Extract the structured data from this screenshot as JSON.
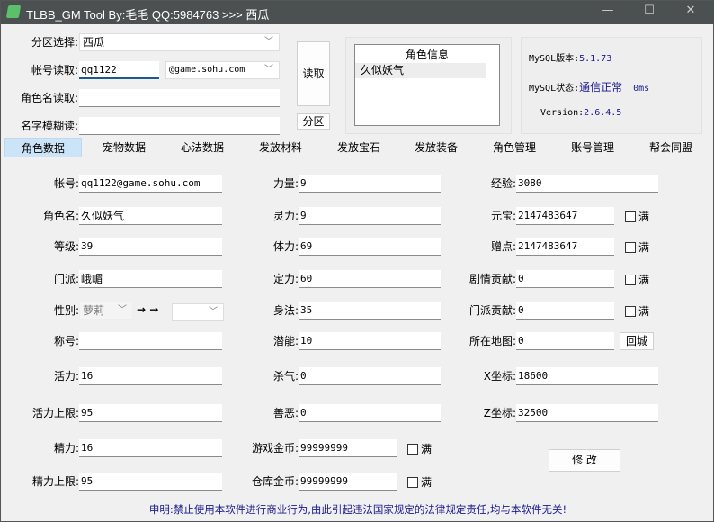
{
  "window": {
    "title": "TLBB_GM Tool By:毛毛 QQ:5984763 >>> 西瓜",
    "min": "—",
    "max": "☐",
    "close": "✕"
  },
  "top": {
    "zone_label": "分区选择:",
    "zone_value": "西瓜",
    "account_label": "帐号读取:",
    "account_value": "qq1122",
    "domain_value": "@game.sohu.com",
    "rolename_label": "角色名读取:",
    "rolename_value": "",
    "fuzzy_label": "名字模糊读:",
    "fuzzy_value": "",
    "read_button": "读取",
    "zone_button": "分区"
  },
  "role_list": {
    "header": "角色信息",
    "items": [
      "久似妖气"
    ]
  },
  "mysql": {
    "version_label": "MySQL版本:",
    "version": "5.1.73",
    "status_label": "MySQL状态:",
    "status": "通信正常",
    "ping": "0ms",
    "tool_version_label": "Version:",
    "tool_version": "2.6.4.5"
  },
  "tabs": [
    "角色数据",
    "宠物数据",
    "心法数据",
    "发放材料",
    "发放宝石",
    "发放装备",
    "角色管理",
    "账号管理",
    "帮会同盟"
  ],
  "fields": {
    "col1": [
      {
        "label": "帐号:",
        "value": "qq1122@game.sohu.com"
      },
      {
        "label": "角色名:",
        "value": "久似妖气"
      },
      {
        "label": "等级:",
        "value": "39"
      },
      {
        "label": "门派:",
        "value": "峨嵋"
      },
      {
        "label": "性别:",
        "value": "萝莉",
        "to_value": "",
        "arrow": "→ →"
      },
      {
        "label": "称号:",
        "value": ""
      },
      {
        "label": "活力:",
        "value": "16"
      },
      {
        "label": "活力上限:",
        "value": "95"
      },
      {
        "label": "精力:",
        "value": "16"
      },
      {
        "label": "精力上限:",
        "value": "95"
      }
    ],
    "col2": [
      {
        "label": "力量:",
        "value": "9"
      },
      {
        "label": "灵力:",
        "value": "9"
      },
      {
        "label": "体力:",
        "value": "69"
      },
      {
        "label": "定力:",
        "value": "60"
      },
      {
        "label": "身法:",
        "value": "35"
      },
      {
        "label": "潜能:",
        "value": "10"
      },
      {
        "label": "杀气:",
        "value": "0"
      },
      {
        "label": "善恶:",
        "value": "0"
      },
      {
        "label": "游戏金币:",
        "value": "99999999",
        "check": "满"
      },
      {
        "label": "仓库金币:",
        "value": "99999999",
        "check": "满"
      }
    ],
    "col3": [
      {
        "label": "经验:",
        "value": "3080"
      },
      {
        "label": "元宝:",
        "value": "2147483647",
        "check": "满"
      },
      {
        "label": "赠点:",
        "value": "2147483647",
        "check": "满"
      },
      {
        "label": "剧情贡献:",
        "value": "0",
        "check": "满"
      },
      {
        "label": "门派贡献:",
        "value": "0",
        "check": "满"
      },
      {
        "label": "所在地图:",
        "value": "0",
        "button": "回城"
      },
      {
        "label": "X坐标:",
        "value": "18600"
      },
      {
        "label": "Z坐标:",
        "value": "32500"
      }
    ]
  },
  "modify_button": "修 改",
  "footer": "申明:禁止使用本软件进行商业行为,由此引起违法国家规定的法律规定责任,均与本软件无关!"
}
